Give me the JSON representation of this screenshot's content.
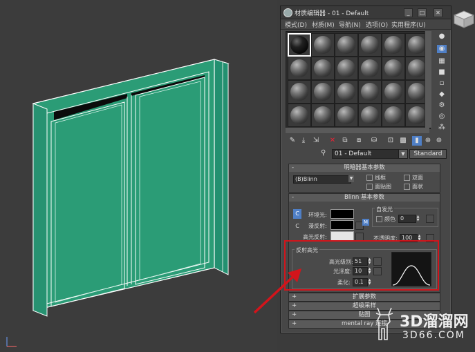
{
  "window": {
    "title": "材质编辑器 - 01 - Default",
    "minimize": "_",
    "maximize": "□",
    "close": "✕"
  },
  "menu": {
    "items": [
      {
        "label": "模式(D)"
      },
      {
        "label": "材质(M)"
      },
      {
        "label": "导航(N)"
      },
      {
        "label": "选项(O)"
      },
      {
        "label": "实用程序(U)"
      }
    ]
  },
  "material": {
    "name": "01 - Default",
    "type": "Standard"
  },
  "shader_rollout": {
    "title": "明暗器基本参数",
    "shader": "(B)Blinn",
    "checkboxes": {
      "wire": "线框",
      "two_sided": "双面",
      "face_map": "面贴图",
      "faceted": "面状"
    }
  },
  "blinn_rollout": {
    "title": "Blinn 基本参数",
    "ambient": "环境光:",
    "diffuse": "漫反射:",
    "specular": "高光反射:",
    "self_illum_title": "自发光",
    "color_label": "颜色",
    "self_illum_value": "0",
    "opacity_label": "不透明度:",
    "opacity_value": "100",
    "lock": "C",
    "map_marker": "M",
    "ambient_color": "#000000",
    "diffuse_color": "#000000",
    "specular_color": "#e5e5e5"
  },
  "specular_highlights": {
    "title": "反射高光",
    "level_label": "高光级别:",
    "level_value": "51",
    "gloss_label": "光泽度:",
    "gloss_value": "10",
    "soften_label": "柔化:",
    "soften_value": "0.1"
  },
  "collapsed_rollouts": [
    {
      "label": "扩展参数"
    },
    {
      "label": "超级采样"
    },
    {
      "label": "贴图"
    },
    {
      "label": "mental ray 连接"
    }
  ],
  "watermark": {
    "text": "3D溜溜网",
    "url": "3D66.COM"
  },
  "colors": {
    "door_face": "#2b9c76",
    "door_edge": "#ffffff",
    "highlight_box": "#d3141b",
    "arrow": "#d3141b"
  }
}
